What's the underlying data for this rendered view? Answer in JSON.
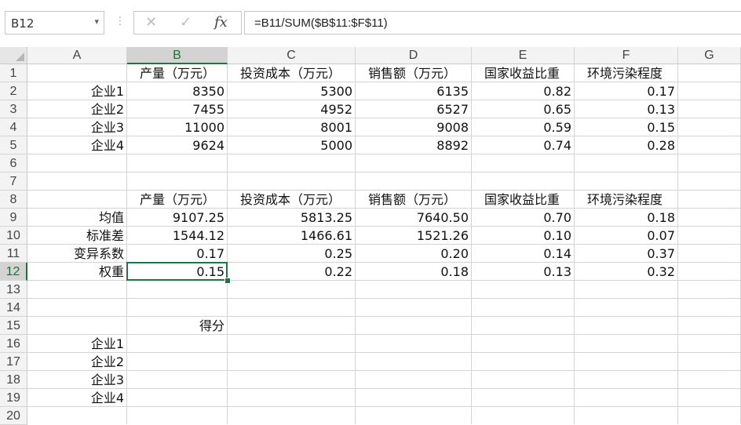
{
  "name_box": {
    "value": "B12"
  },
  "formula_bar": {
    "cancel": "✕",
    "enter": "✓",
    "fx": "fx",
    "formula": "=B11/SUM($B$11:$F$11)"
  },
  "columns": [
    "A",
    "B",
    "C",
    "D",
    "E",
    "F",
    "G"
  ],
  "rows": [
    "1",
    "2",
    "3",
    "4",
    "5",
    "6",
    "7",
    "8",
    "9",
    "10",
    "11",
    "12",
    "13",
    "14",
    "15",
    "16",
    "17",
    "18",
    "19",
    "20"
  ],
  "selected": {
    "column": "B",
    "row": "12"
  },
  "accent_color": "#217346",
  "sheet": {
    "header1": [
      "产量（万元）",
      "投资成本（万元）",
      "销售额（万元）",
      "国家收益比重",
      "环境污染程度"
    ],
    "companies": [
      {
        "name": "企业1",
        "values": [
          "8350",
          "5300",
          "6135",
          "0.82",
          "0.17"
        ]
      },
      {
        "name": "企业2",
        "values": [
          "7455",
          "4952",
          "6527",
          "0.65",
          "0.13"
        ]
      },
      {
        "name": "企业3",
        "values": [
          "11000",
          "8001",
          "9008",
          "0.59",
          "0.15"
        ]
      },
      {
        "name": "企业4",
        "values": [
          "9624",
          "5000",
          "8892",
          "0.74",
          "0.28"
        ]
      }
    ],
    "header2": [
      "产量（万元）",
      "投资成本（万元）",
      "销售额（万元）",
      "国家收益比重",
      "环境污染程度"
    ],
    "stats": [
      {
        "name": "均值",
        "values": [
          "9107.25",
          "5813.25",
          "7640.50",
          "0.70",
          "0.18"
        ]
      },
      {
        "name": "标准差",
        "values": [
          "1544.12",
          "1466.61",
          "1521.26",
          "0.10",
          "0.07"
        ]
      },
      {
        "name": "变异系数",
        "values": [
          "0.17",
          "0.25",
          "0.20",
          "0.14",
          "0.37"
        ]
      },
      {
        "name": "权重",
        "values": [
          "0.15",
          "0.22",
          "0.18",
          "0.13",
          "0.32"
        ]
      }
    ],
    "score_label": "得分",
    "score_rows": [
      "企业1",
      "企业2",
      "企业3",
      "企业4"
    ]
  }
}
